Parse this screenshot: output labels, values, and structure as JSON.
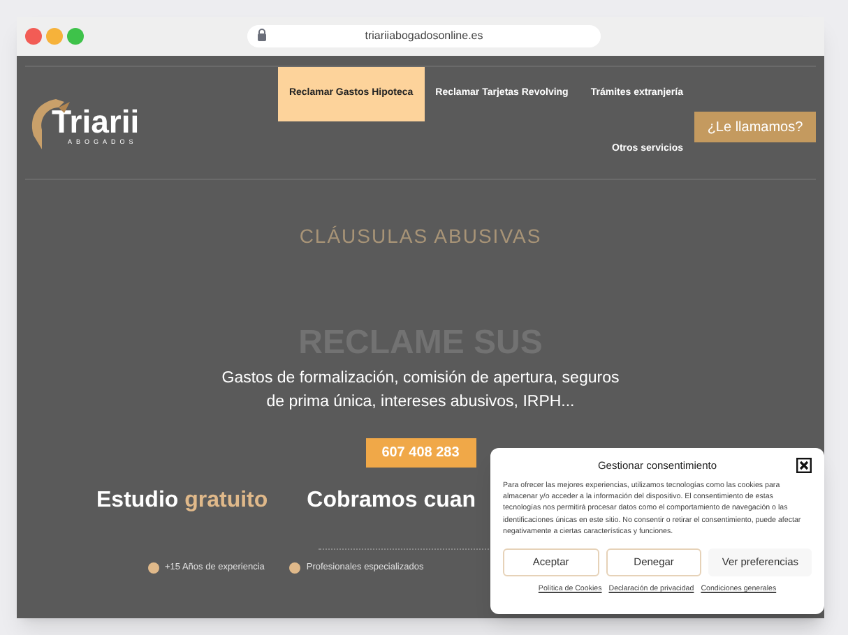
{
  "browser": {
    "url": "triariiabogadosonline.es"
  },
  "header": {
    "logo": {
      "name": "Triarii",
      "tagline": "ABOGADOS"
    },
    "menu": [
      {
        "label": "Reclamar Gastos Hipoteca",
        "selected": true
      },
      {
        "label": "Reclamar Tarjetas Revolving",
        "selected": false
      },
      {
        "label": "Trámites extranjería",
        "selected": false
      },
      {
        "label": "Otros servicios",
        "selected": false
      }
    ],
    "call_button": "¿Le llamamos?"
  },
  "hero": {
    "eyebrow": "CLÁUSULAS ABUSIVAS",
    "ghost_heading": "RECLAME SUS",
    "description": "Gastos de formalización, comisión de apertura, seguros de prima única, intereses abusivos, IRPH...",
    "phone_button": "607 408 283"
  },
  "features": [
    {
      "parts": [
        {
          "text": "Estudio ",
          "accent": false
        },
        {
          "text": "gratuito",
          "accent": true
        }
      ]
    },
    {
      "parts": [
        {
          "text": "Cobramos cuan",
          "accent": false
        }
      ]
    }
  ],
  "badges": [
    "+15 Años de experiencia",
    "Profesionales especializados"
  ],
  "consent": {
    "title": "Gestionar consentimiento",
    "body": "Para ofrecer las mejores experiencias, utilizamos tecnologías como las cookies para almacenar y/o acceder a la información del dispositivo. El consentimiento de estas tecnologías nos permitirá procesar datos como el comportamiento de navegación o las identificaciones únicas en este sitio. No consentir o retirar el consentimiento, puede afectar negativamente a ciertas características y funciones.",
    "buttons": [
      {
        "label": "Aceptar",
        "kind": "outlined"
      },
      {
        "label": "Denegar",
        "kind": "outlined"
      },
      {
        "label": "Ver preferencias",
        "kind": "plain"
      }
    ],
    "links": [
      "Política de Cookies",
      "Declaración de privacidad",
      "Condiciones generales"
    ]
  }
}
